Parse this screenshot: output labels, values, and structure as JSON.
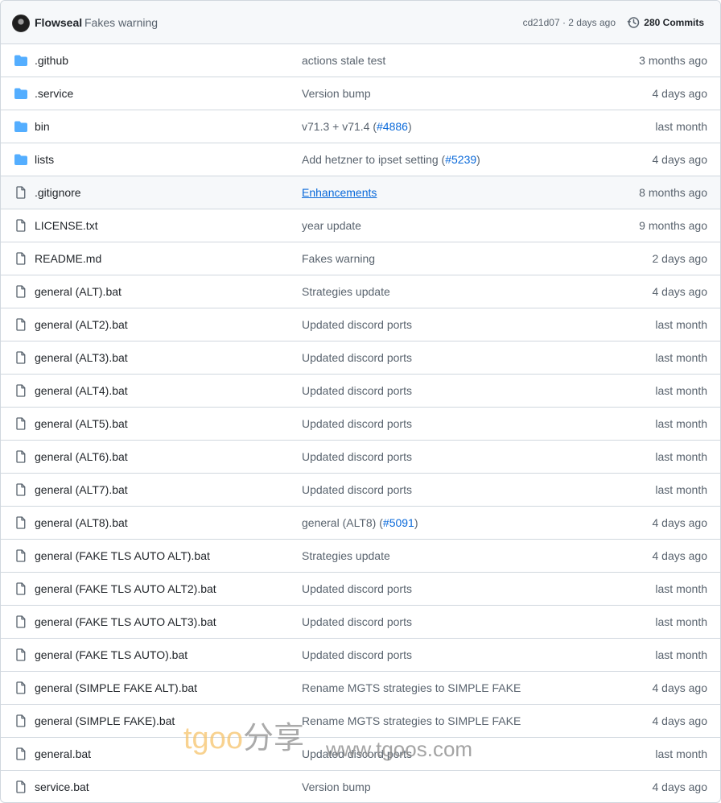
{
  "latest_commit": {
    "author": "Flowseal",
    "message": "Fakes warning",
    "sha_time": "cd21d07 · 2 days ago",
    "commits_label": "280 Commits"
  },
  "files": [
    {
      "type": "folder",
      "name": ".github",
      "msg": "actions stale test",
      "link": "",
      "msg_after": "",
      "age": "3 months ago"
    },
    {
      "type": "folder",
      "name": ".service",
      "msg": "Version bump",
      "link": "",
      "msg_after": "",
      "age": "4 days ago"
    },
    {
      "type": "folder",
      "name": "bin",
      "msg": "v71.3 + v71.4 (",
      "link": "#4886",
      "msg_after": ")",
      "age": "last month"
    },
    {
      "type": "folder",
      "name": "lists",
      "msg": "Add hetzner to ipset setting (",
      "link": "#5239",
      "msg_after": ")",
      "age": "4 days ago"
    },
    {
      "type": "file",
      "name": ".gitignore",
      "msg": "",
      "link": "Enhancements",
      "msg_after": "",
      "age": "8 months ago"
    },
    {
      "type": "file",
      "name": "LICENSE.txt",
      "msg": "year update",
      "link": "",
      "msg_after": "",
      "age": "9 months ago"
    },
    {
      "type": "file",
      "name": "README.md",
      "msg": "Fakes warning",
      "link": "",
      "msg_after": "",
      "age": "2 days ago"
    },
    {
      "type": "file",
      "name": "general (ALT).bat",
      "msg": "Strategies update",
      "link": "",
      "msg_after": "",
      "age": "4 days ago"
    },
    {
      "type": "file",
      "name": "general (ALT2).bat",
      "msg": "Updated discord ports",
      "link": "",
      "msg_after": "",
      "age": "last month"
    },
    {
      "type": "file",
      "name": "general (ALT3).bat",
      "msg": "Updated discord ports",
      "link": "",
      "msg_after": "",
      "age": "last month"
    },
    {
      "type": "file",
      "name": "general (ALT4).bat",
      "msg": "Updated discord ports",
      "link": "",
      "msg_after": "",
      "age": "last month"
    },
    {
      "type": "file",
      "name": "general (ALT5).bat",
      "msg": "Updated discord ports",
      "link": "",
      "msg_after": "",
      "age": "last month"
    },
    {
      "type": "file",
      "name": "general (ALT6).bat",
      "msg": "Updated discord ports",
      "link": "",
      "msg_after": "",
      "age": "last month"
    },
    {
      "type": "file",
      "name": "general (ALT7).bat",
      "msg": "Updated discord ports",
      "link": "",
      "msg_after": "",
      "age": "last month"
    },
    {
      "type": "file",
      "name": "general (ALT8).bat",
      "msg": "general (ALT8) (",
      "link": "#5091",
      "msg_after": ")",
      "age": "4 days ago"
    },
    {
      "type": "file",
      "name": "general (FAKE TLS AUTO ALT).bat",
      "msg": "Strategies update",
      "link": "",
      "msg_after": "",
      "age": "4 days ago"
    },
    {
      "type": "file",
      "name": "general (FAKE TLS AUTO ALT2).bat",
      "msg": "Updated discord ports",
      "link": "",
      "msg_after": "",
      "age": "last month"
    },
    {
      "type": "file",
      "name": "general (FAKE TLS AUTO ALT3).bat",
      "msg": "Updated discord ports",
      "link": "",
      "msg_after": "",
      "age": "last month"
    },
    {
      "type": "file",
      "name": "general (FAKE TLS AUTO).bat",
      "msg": "Updated discord ports",
      "link": "",
      "msg_after": "",
      "age": "last month"
    },
    {
      "type": "file",
      "name": "general (SIMPLE FAKE ALT).bat",
      "msg": "Rename MGTS strategies to SIMPLE FAKE",
      "link": "",
      "msg_after": "",
      "age": "4 days ago"
    },
    {
      "type": "file",
      "name": "general (SIMPLE FAKE).bat",
      "msg": "Rename MGTS strategies to SIMPLE FAKE",
      "link": "",
      "msg_after": "",
      "age": "4 days ago"
    },
    {
      "type": "file",
      "name": "general.bat",
      "msg": "Updated discord ports",
      "link": "",
      "msg_after": "",
      "age": "last month"
    },
    {
      "type": "file",
      "name": "service.bat",
      "msg": "Version bump",
      "link": "",
      "msg_after": "",
      "age": "4 days ago"
    }
  ],
  "watermark": {
    "brand_a": "tgoo",
    "brand_b": "分享",
    "url": "www.tgoos.com"
  },
  "colors": {
    "folder": "#54aeff",
    "link": "#0969da",
    "muted": "#59636e",
    "border": "#d0d7de"
  }
}
